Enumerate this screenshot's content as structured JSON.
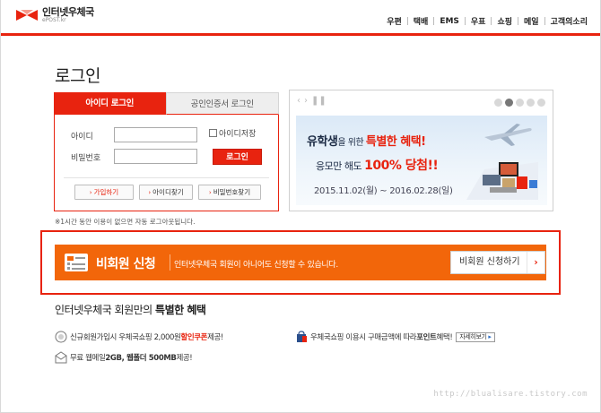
{
  "header": {
    "logo_main": "인터넷우체국",
    "logo_sub": "ePOST.kr",
    "nav": [
      "우편",
      "택배",
      "EMS",
      "우표",
      "쇼핑",
      "메일",
      "고객의소리"
    ]
  },
  "page_title": "로그인",
  "login": {
    "tabs": [
      {
        "label": "아이디 로그인",
        "active": true
      },
      {
        "label": "공인인증서 로그인",
        "active": false
      }
    ],
    "id_label": "아이디",
    "pw_label": "비밀번호",
    "id_value": "",
    "pw_value": "",
    "save_id_label": "아이디저장",
    "login_button": "로그인",
    "links": [
      "가입하기",
      "아이디찾기",
      "비밀번호찾기"
    ]
  },
  "banner": {
    "line1_a": "유학생",
    "line1_b": "을 위한 ",
    "line1_c": "특별한 혜택!",
    "line2_a": "응모만 해도 ",
    "line2_b": "100% 당첨!!",
    "date": "2015.11.02(월) ~ 2016.02.28(일)",
    "dot_count": 5,
    "active_dot": 2
  },
  "notice": "※1시간 동안 이용이 없으면 자동 로그아웃됩니다.",
  "non_member": {
    "title": "비회원 신청",
    "desc": "인터넷우체국 회원이 아니어도 신청할 수 있습니다.",
    "button": "비회원 신청하기"
  },
  "benefits": {
    "title_a": "인터넷우체국 회원만의 ",
    "title_b": "특별한 혜택",
    "items": [
      {
        "a": "신규회원가입시 우체국쇼핑 2,000원 ",
        "b": "할인쿠폰",
        "c": " 제공!"
      },
      {
        "a": "우체국쇼핑 이용시 구매금액에 따라 ",
        "b": "포인트",
        "c": " 혜택!"
      },
      {
        "a": "무료 웹메일 ",
        "b": "2GB, 웹폴더 500MB",
        "c": " 제공!"
      }
    ],
    "more_label": "자세히보기"
  },
  "watermark": "http://blualisare.tistory.com",
  "colors": {
    "accent": "#e8230f",
    "orange": "#f2660a"
  }
}
